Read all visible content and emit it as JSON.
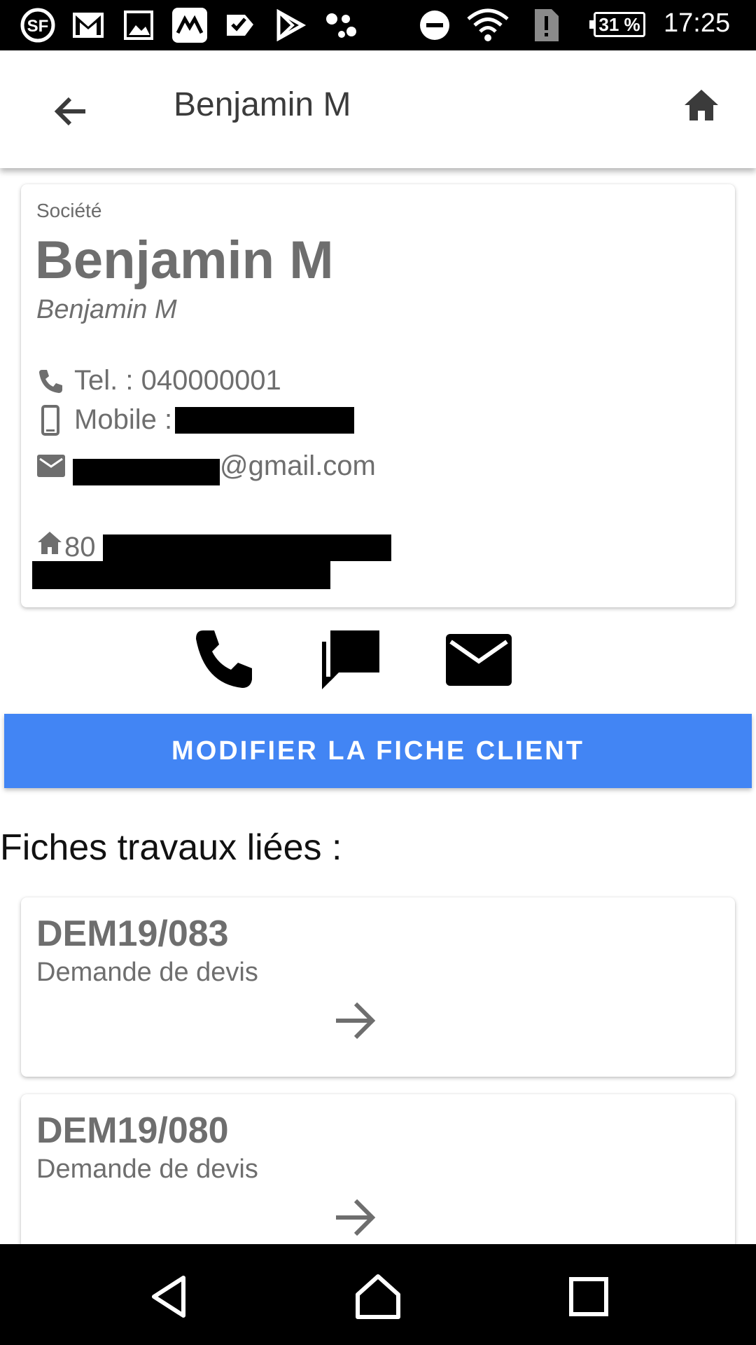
{
  "status_bar": {
    "battery_percent": "31 %",
    "time": "17:25",
    "icons": [
      "sf-app-icon",
      "gmail-icon",
      "gallery-icon",
      "app-icon",
      "tasks-icon",
      "play-store-icon",
      "assistant-icon",
      "dnd-icon",
      "wifi-icon",
      "sim-alert-icon",
      "battery-icon"
    ]
  },
  "appbar": {
    "title": "Benjamin M",
    "back_icon": "arrow-back-icon",
    "home_icon": "home-icon"
  },
  "client": {
    "company_label": "Société",
    "name": "Benjamin M",
    "subname": "Benjamin M",
    "phone_label": "Tel. : 040000001",
    "mobile_label": "Mobile :",
    "email_suffix": "@gmail.com",
    "address_prefix": "80"
  },
  "actions": {
    "call_icon": "phone-icon",
    "sms_icon": "message-icon",
    "email_icon": "mail-icon"
  },
  "edit_button": {
    "label": "MODIFIER LA FICHE CLIENT",
    "color": "#4285f4"
  },
  "linked_jobs": {
    "title": "Fiches travaux liées :",
    "items": [
      {
        "ref": "DEM19/083",
        "type": "Demande de devis"
      },
      {
        "ref": "DEM19/080",
        "type": "Demande de devis"
      }
    ]
  },
  "nav_bar": {
    "icons": [
      "back-triangle-icon",
      "home-circle-icon",
      "recents-square-icon"
    ]
  }
}
